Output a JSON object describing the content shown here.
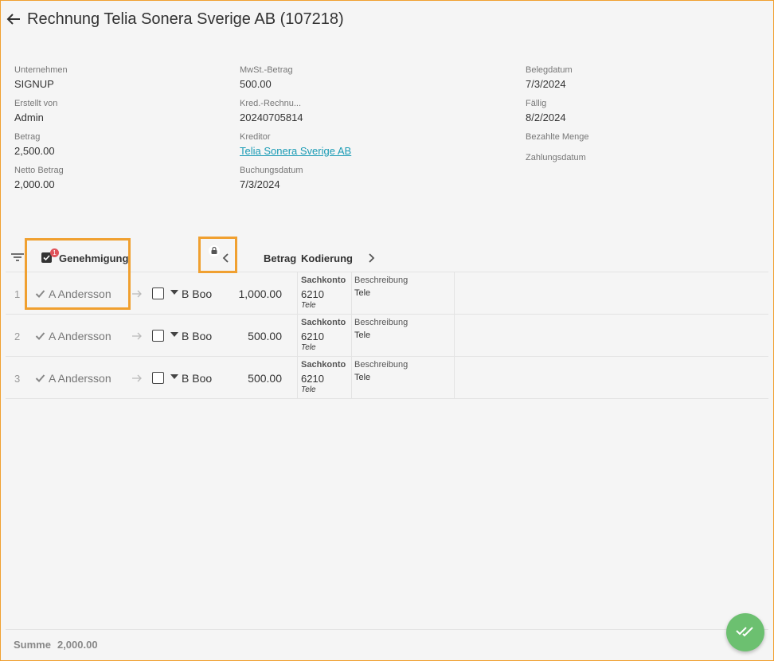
{
  "title": "Rechnung Telia Sonera Sverige AB (107218)",
  "info": {
    "col1": [
      {
        "label": "Unternehmen",
        "value": "SIGNUP"
      },
      {
        "label": "Erstellt von",
        "value": "Admin"
      },
      {
        "label": "Betrag",
        "value": "2,500.00"
      },
      {
        "label": "Netto Betrag",
        "value": "2,000.00"
      }
    ],
    "col2": [
      {
        "label": "MwSt.-Betrag",
        "value": "500.00"
      },
      {
        "label": "Kred.-Rechnu...",
        "value": "20240705814"
      },
      {
        "label": "Kreditor",
        "value": "Telia Sonera Sverige AB"
      },
      {
        "label": "Buchungsdatum",
        "value": "7/3/2024"
      }
    ],
    "col3": [
      {
        "label": "Belegdatum",
        "value": "7/3/2024"
      },
      {
        "label": "Fällig",
        "value": "8/2/2024"
      },
      {
        "label": "Bezahlte Menge",
        "value": ""
      },
      {
        "label": "Zahlungsdatum",
        "value": ""
      }
    ]
  },
  "grid": {
    "header": {
      "badge": "1",
      "approval": "Genehmigung",
      "amount": "Betrag",
      "coding": "Kodierung"
    },
    "rows": [
      {
        "num": "1",
        "approver": "A Andersson",
        "next": "B Boo",
        "amount": "1,000.00",
        "sk_label": "Sachkonto",
        "sk_value": "6210",
        "sk_sub": "Tele",
        "desc_label": "Beschreibung",
        "desc_value": "Tele"
      },
      {
        "num": "2",
        "approver": "A Andersson",
        "next": "B Boo",
        "amount": "500.00",
        "sk_label": "Sachkonto",
        "sk_value": "6210",
        "sk_sub": "Tele",
        "desc_label": "Beschreibung",
        "desc_value": "Tele"
      },
      {
        "num": "3",
        "approver": "A Andersson",
        "next": "B Boo",
        "amount": "500.00",
        "sk_label": "Sachkonto",
        "sk_value": "6210",
        "sk_sub": "Tele",
        "desc_label": "Beschreibung",
        "desc_value": "Tele"
      }
    ]
  },
  "footer": {
    "sum_label": "Summe",
    "sum_value": "2,000.00"
  },
  "colors": {
    "accent_link": "#1a9bb5",
    "fab": "#6cc070",
    "badge": "#e0535a",
    "highlight": "#f0a030"
  }
}
